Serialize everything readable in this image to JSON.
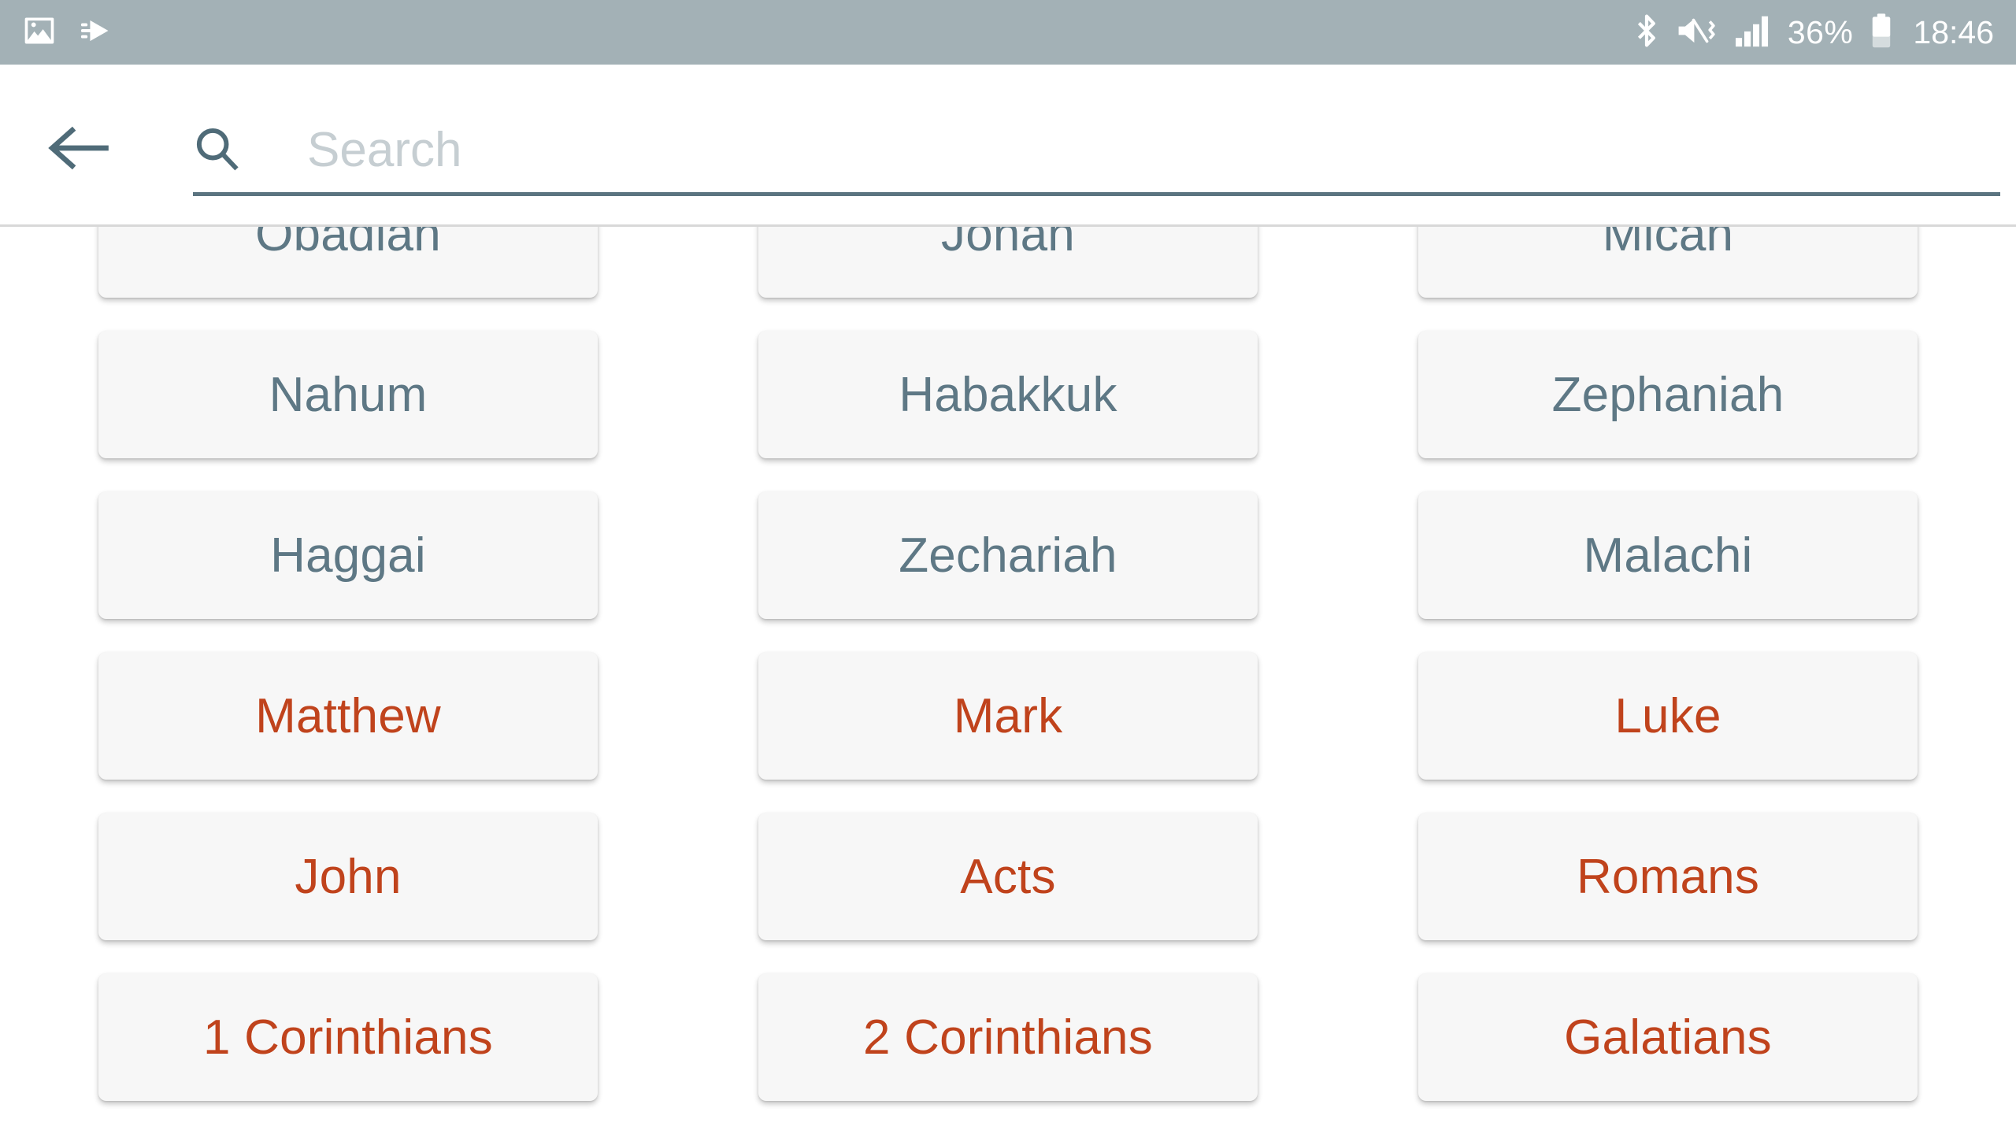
{
  "status_bar": {
    "background_color": "#a3b1b6",
    "left_icons": [
      {
        "name": "image-icon",
        "label": "Screenshot captured"
      },
      {
        "name": "send-icon",
        "label": "Sharing"
      }
    ],
    "right_icons": [
      {
        "name": "bluetooth-icon",
        "label": "Bluetooth"
      },
      {
        "name": "mute-vibrate-icon",
        "label": "Sound off vibrate"
      },
      {
        "name": "signal-bars-icon",
        "label": "Mobile signal"
      }
    ],
    "battery_percent": "36%",
    "battery_icon": "battery-icon",
    "clock": "18:46"
  },
  "search": {
    "back_icon": "back-arrow-icon",
    "search_icon": "search-icon",
    "placeholder": "Search",
    "value": "",
    "underline_color": "#5b7480"
  },
  "books": {
    "ot_color": "#5e7885",
    "nt_color": "#c0431c",
    "rows": [
      [
        {
          "label": "Obadiah",
          "testament": "ot"
        },
        {
          "label": "Jonah",
          "testament": "ot"
        },
        {
          "label": "Micah",
          "testament": "ot"
        }
      ],
      [
        {
          "label": "Nahum",
          "testament": "ot"
        },
        {
          "label": "Habakkuk",
          "testament": "ot"
        },
        {
          "label": "Zephaniah",
          "testament": "ot"
        }
      ],
      [
        {
          "label": "Haggai",
          "testament": "ot"
        },
        {
          "label": "Zechariah",
          "testament": "ot"
        },
        {
          "label": "Malachi",
          "testament": "ot"
        }
      ],
      [
        {
          "label": "Matthew",
          "testament": "nt"
        },
        {
          "label": "Mark",
          "testament": "nt"
        },
        {
          "label": "Luke",
          "testament": "nt"
        }
      ],
      [
        {
          "label": "John",
          "testament": "nt"
        },
        {
          "label": "Acts",
          "testament": "nt"
        },
        {
          "label": "Romans",
          "testament": "nt"
        }
      ],
      [
        {
          "label": "1 Corinthians",
          "testament": "nt"
        },
        {
          "label": "2 Corinthians",
          "testament": "nt"
        },
        {
          "label": "Galatians",
          "testament": "nt"
        }
      ]
    ]
  }
}
